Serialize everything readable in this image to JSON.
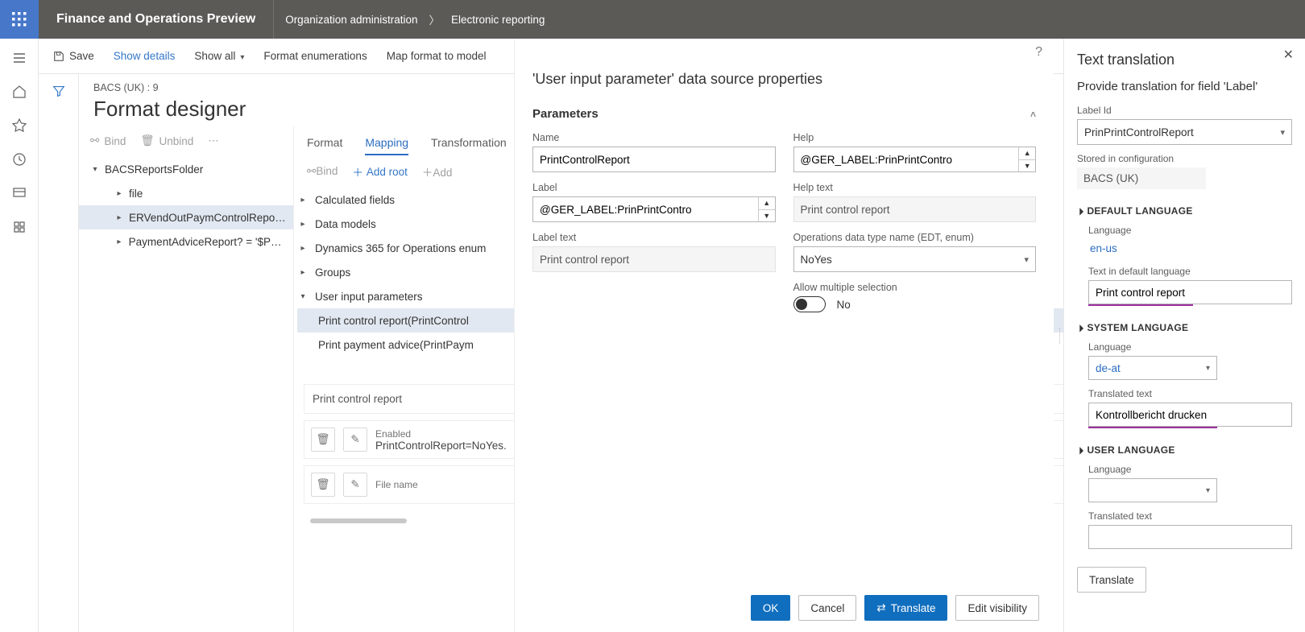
{
  "top": {
    "app_title": "Finance and Operations Preview",
    "breadcrumb": [
      "Organization administration",
      "Electronic reporting"
    ]
  },
  "toolbar": {
    "save": "Save",
    "show_details": "Show details",
    "show_all": "Show all",
    "format_enumerations": "Format enumerations",
    "map_format": "Map format to model"
  },
  "page": {
    "subtitle": "BACS (UK) : 9",
    "title": "Format designer"
  },
  "left_toolbar": {
    "bind": "Bind",
    "unbind": "Unbind"
  },
  "left_tree": [
    {
      "level": 1,
      "expand": "▾",
      "label": "BACSReportsFolder"
    },
    {
      "level": 2,
      "expand": "▸",
      "label": "file"
    },
    {
      "level": 2,
      "expand": "▸",
      "label": "ERVendOutPaymControlReport?",
      "selected": true
    },
    {
      "level": 2,
      "expand": "▸",
      "label": "PaymentAdviceReport? = '$Paym"
    }
  ],
  "tabs": {
    "format": "Format",
    "mapping": "Mapping",
    "transformations": "Transformation"
  },
  "rt_toolbar": {
    "bind": "Bind",
    "add_root": "Add root",
    "add": "Add"
  },
  "ds_tree": [
    {
      "type": "group",
      "label": "Calculated fields"
    },
    {
      "type": "group",
      "label": "Data models"
    },
    {
      "type": "group",
      "label": "Dynamics 365 for Operations enum"
    },
    {
      "type": "group",
      "label": "Groups"
    },
    {
      "type": "group",
      "label": "User input parameters",
      "expanded": true
    },
    {
      "type": "leaf",
      "label": "Print control report(PrintControl",
      "selected": true
    },
    {
      "type": "leaf",
      "label": "Print payment advice(PrintPaym"
    }
  ],
  "details": {
    "title": "Print control report",
    "cards": [
      {
        "label": "Enabled",
        "value": "PrintControlReport=NoYes."
      },
      {
        "label": "File name",
        "value": ""
      }
    ]
  },
  "dialog": {
    "title": "'User input parameter' data source properties",
    "section": "Parameters",
    "fields": {
      "name_label": "Name",
      "name_value": "PrintControlReport",
      "label_label": "Label",
      "label_value": "@GER_LABEL:PrinPrintContro",
      "labeltext_label": "Label text",
      "labeltext_value": "Print control report",
      "help_label": "Help",
      "help_value": "@GER_LABEL:PrinPrintContro",
      "helptext_label": "Help text",
      "helptext_value": "Print control report",
      "edt_label": "Operations data type name (EDT, enum)",
      "edt_value": "NoYes",
      "allowmulti_label": "Allow multiple selection",
      "allowmulti_value": "No"
    },
    "actions": {
      "ok": "OK",
      "cancel": "Cancel",
      "translate": "Translate",
      "edit_visibility": "Edit visibility"
    }
  },
  "flyout": {
    "title": "Text translation",
    "subtitle": "Provide translation for field 'Label'",
    "labelid_label": "Label Id",
    "labelid_value": "PrinPrintControlReport",
    "stored_label": "Stored in configuration",
    "stored_value": "BACS (UK)",
    "default_section": "DEFAULT LANGUAGE",
    "default_lang_label": "Language",
    "default_lang": "en-us",
    "default_text_label": "Text in default language",
    "default_text": "Print control report",
    "system_section": "SYSTEM LANGUAGE",
    "system_lang_label": "Language",
    "system_lang": "de-at",
    "translated_text_label": "Translated text",
    "translated_text": "Kontrollbericht drucken",
    "user_section": "USER LANGUAGE",
    "user_lang_label": "Language",
    "user_text_label": "Translated text",
    "translate_btn": "Translate"
  }
}
